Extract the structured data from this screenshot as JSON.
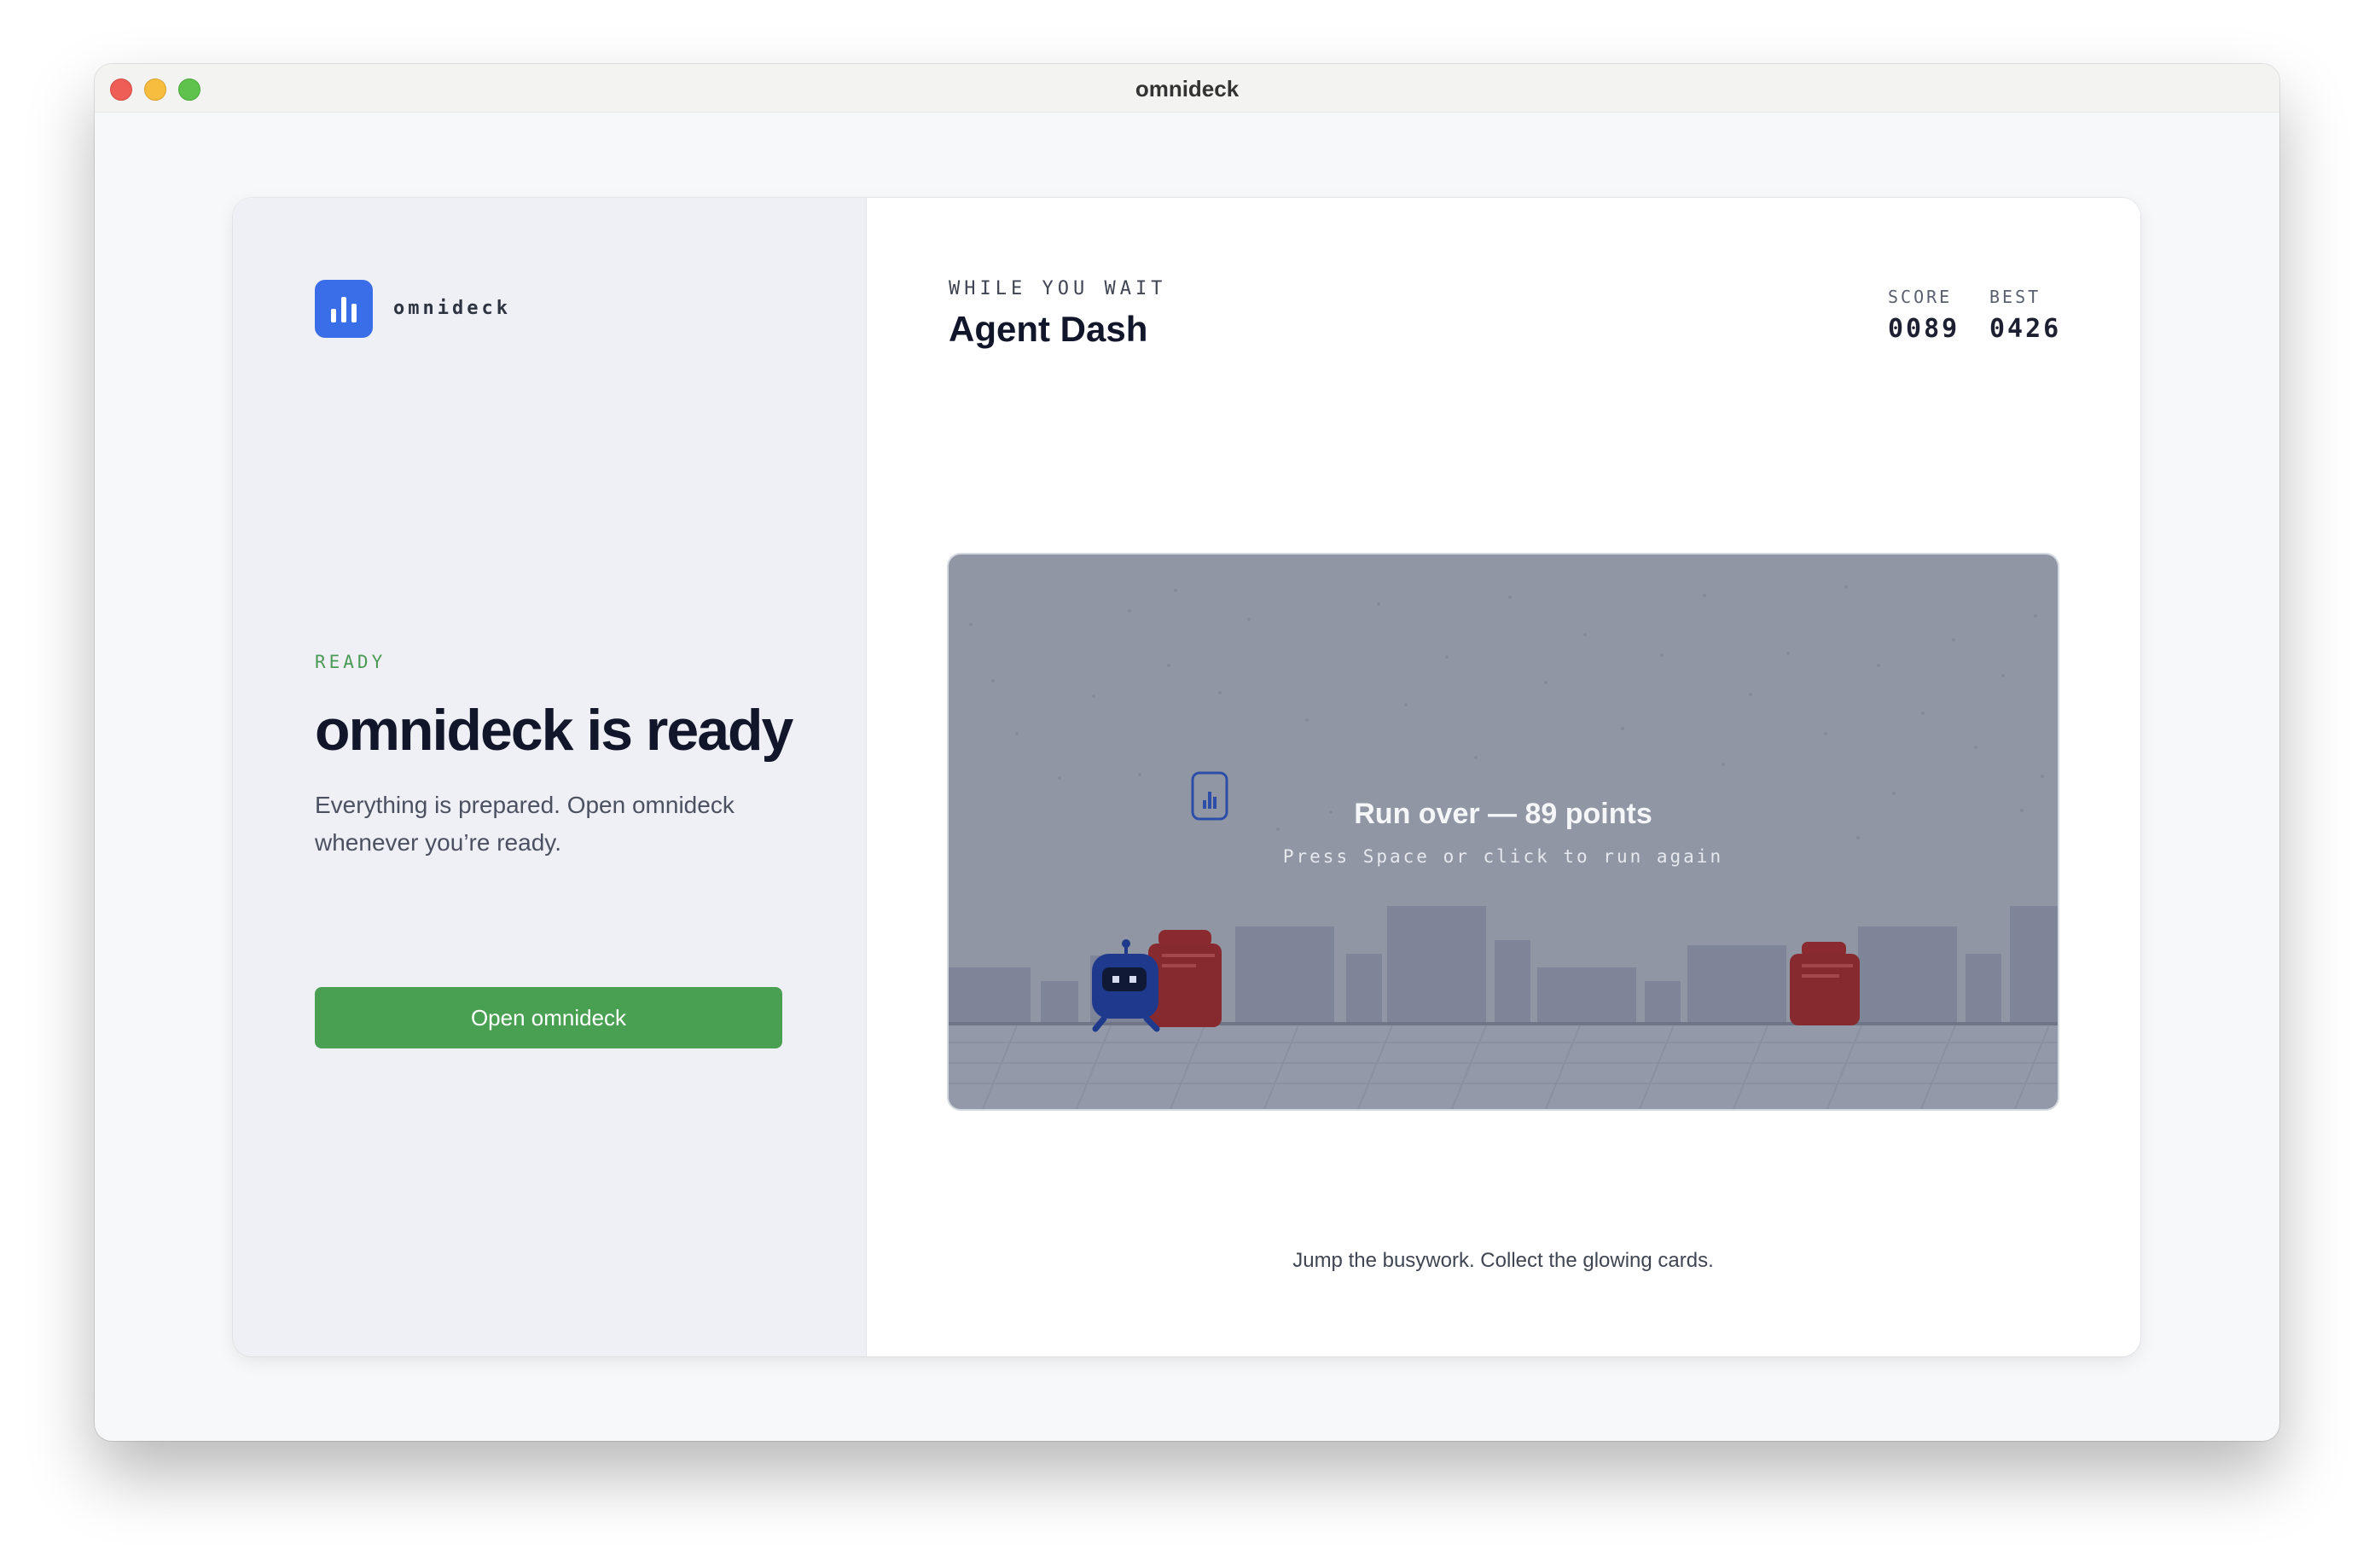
{
  "window": {
    "title": "omnideck"
  },
  "sidebar": {
    "brand": "omnideck",
    "status_label": "READY",
    "headline": "omnideck is ready",
    "description": "Everything is prepared. Open omnideck whenever you’re ready.",
    "open_button_label": "Open omnideck"
  },
  "game": {
    "eyebrow": "WHILE YOU WAIT",
    "title": "Agent Dash",
    "score_label": "SCORE",
    "score_value": "0089",
    "best_label": "BEST",
    "best_value": "0426",
    "overlay_title": "Run over — 89 points",
    "overlay_subtitle": "Press Space or click to run again",
    "hint": "Jump the busywork. Collect the glowing cards."
  },
  "colors": {
    "accent_blue": "#3a6ee8",
    "ready_green": "#4a9a55",
    "button_green": "#4aa052",
    "obstacle_red": "#8a2a2e",
    "agent_blue": "#1f3a8c"
  },
  "icons": {
    "logo": "bar-chart-icon",
    "collectible": "glowing-card-icon",
    "player": "robot-agent-icon",
    "obstacle": "briefcase-icon"
  }
}
